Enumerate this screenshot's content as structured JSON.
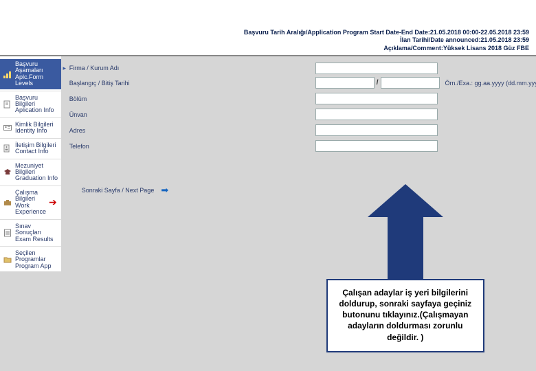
{
  "header": {
    "line1": "Başvuru Tarih Aralığı/Application Program Start Date-End Date:21.05.2018 00:00-22.05.2018 23:59",
    "line2": "İlan Tarihi/Date announced:21.05.2018 23:59",
    "line3": "Açıklama/Comment:Yüksek Lisans 2018 Güz FBE"
  },
  "sidebar": {
    "items": [
      {
        "label": "Başvuru Aşamaları\nAplc.Form Levels"
      },
      {
        "label": "Başvuru Bilgileri\nAplication Info"
      },
      {
        "label": "Kimlik Bilgileri\nIdentity Info"
      },
      {
        "label": "İletişim Bilgileri\nContact Info"
      },
      {
        "label": "Mezuniyet Bilgileri\nGraduation Info"
      },
      {
        "label": "Çalışma Bilgileri\nWork Experience"
      },
      {
        "label": "Sınav Sonuçları\nExam Results"
      },
      {
        "label": "Seçilen Programlar\nProgram App"
      }
    ]
  },
  "form": {
    "company_label": "Firma / Kurum Adı",
    "dates_label": "Başlangıç / Bitiş Tarihi",
    "dates_hint": "Örn./Exa.: gg.aa.yyyy (dd.mm.yyyy)",
    "dept_label": "Bölüm",
    "title_label": "Ünvan",
    "address_label": "Adres",
    "phone_label": "Telefon",
    "slash": "/",
    "next_page": "Sonraki Sayfa / Next Page"
  },
  "callout": {
    "text": "Çalışan adaylar iş yeri bilgilerini doldurup, sonraki sayfaya geçiniz butonunu tıklayınız.(Çalışmayan adayların doldurması zorunlu değildir. )"
  }
}
